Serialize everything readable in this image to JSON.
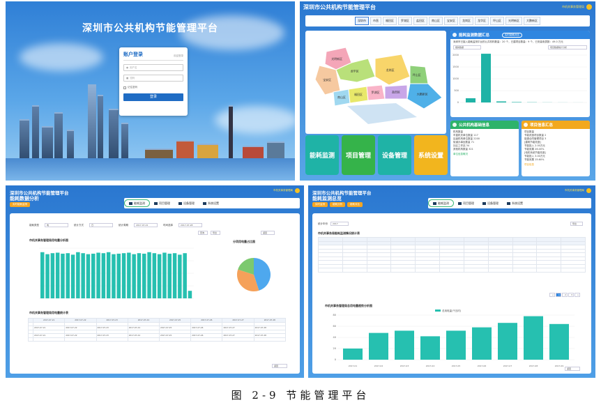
{
  "login_screen": {
    "title": "深圳市公共机构节能管理平台",
    "box_title": "账户登录",
    "box_hint": "欢迎登录",
    "username_placeholder": "用户名",
    "password_placeholder": "密码",
    "remember_label": "记住密码",
    "login_button": "登录"
  },
  "dashboard": {
    "title": "深圳市公共机构节能管理平台",
    "user_label": "市机关事务管理局",
    "districts": [
      "深圳市",
      "市直",
      "福田区",
      "罗湖区",
      "盐田区",
      "南山区",
      "宝安区",
      "龙岗区",
      "龙华区",
      "坪山区",
      "光明新区",
      "大鹏新区"
    ],
    "map_regions": [
      "光明新区",
      "宝安区",
      "龙华区",
      "龙岗区",
      "坪山区",
      "大鹏新区",
      "南山区",
      "福田区",
      "罗湖区",
      "盐田区"
    ],
    "tiles": [
      {
        "label": "能耗监测",
        "color": "#1fb3a6"
      },
      {
        "label": "项目管理",
        "color": "#35b34a"
      },
      {
        "label": "设备管理",
        "color": "#1fb3a6"
      },
      {
        "label": "系统设置",
        "color": "#f2b51e"
      }
    ],
    "monitor_card": {
      "title": "能耗监测数据汇总",
      "button": "实时能耗对比",
      "summary": "深圳市已接入能耗监测平台的公共机构数量：20 个，已建项目数量：9 个，已安装电表数：49.0 万元",
      "select_left": "能耗数据",
      "select_right": "项目数据统计分析",
      "bar_values": [
        200,
        2300,
        50,
        20,
        10,
        5,
        3,
        2
      ],
      "y_ticks": [
        "2000",
        "1500",
        "1000",
        "500",
        "0"
      ]
    },
    "info_card": {
      "title": "公共机构基础信息",
      "lines": [
        "机构数量",
        "市直机关单位数量  117",
        "区级机构单位数量  2200",
        "街道办事处数量  71",
        "社区工作站  34",
        "其他机构数量  321"
      ],
      "note": "机构信息查看请点击相应行，实时数据更新",
      "link": "单位信息概况"
    },
    "project_card": {
      "title": "项目信息汇总",
      "lines": [
        "项目数量",
        "节能改造项目数量  2",
        "能源合同管理项目  3",
        "[建筑节能改造]",
        "节能投入  2.00万元",
        "节能效果  26.00%",
        "[电机系统节能改造]",
        "节能投入  3.00万元",
        "节能效果  15.60%"
      ],
      "link": "项目信息"
    }
  },
  "analysis_screen": {
    "title": "深圳市公共机构节能管理平台",
    "subtitle": "能耗数据分析",
    "sub_buttons": [
      "实时能耗监测"
    ],
    "user_label": "市机关事务管理局",
    "nav": [
      "能耗监测",
      "项目管理",
      "设备管理",
      "系统设置"
    ],
    "filter_labels": [
      "能耗类型",
      "统计方式",
      "统计周期",
      "时间选择"
    ],
    "filter_values": [
      "电",
      "日",
      "2017-07-21",
      "2017-07-28"
    ],
    "buttons": [
      "查询",
      "导出",
      "返回"
    ],
    "bar_title": "市机关事务管理局用电量分析图",
    "pie_title": "分项用电量占比图",
    "table_title": "市机关事务管理局用电量统计表",
    "back_button": "返回",
    "bar_values": [
      92,
      88,
      90,
      91,
      89,
      90,
      87,
      92,
      90,
      88,
      89,
      91,
      90,
      92,
      88,
      89,
      90,
      91,
      88,
      90,
      89,
      92,
      90,
      88,
      91,
      89,
      90,
      87,
      90,
      15
    ],
    "pie_values": [
      45,
      35,
      20
    ],
    "pie_colors": [
      "#4ea8ee",
      "#f5a15a",
      "#7cc96f"
    ],
    "table_dates": [
      "2017-07-21",
      "2017-07-22",
      "2017-07-23",
      "2017-07-24",
      "2017-07-25",
      "2017-07-26",
      "2017-07-27",
      "2017-07-28"
    ]
  },
  "overview_screen": {
    "title": "深圳市公共机构节能管理平台",
    "subtitle": "能耗监测总览",
    "sub_buttons": [
      "实时监测",
      "能耗分析",
      "能耗对比"
    ],
    "user_label": "市机关事务管理局",
    "nav": [
      "能耗监测",
      "项目管理",
      "设备管理",
      "系统设置"
    ],
    "year_label": "统计年份",
    "year_value": "2017",
    "export_button": "导出",
    "table_title": "市机关事务局能耗监测情况统计表",
    "pager": [
      "<",
      "1",
      "2",
      "3",
      ">"
    ],
    "chart_title": "市机关事务管理局总用电量趋势分析图",
    "chart_legend": "总用电量(千瓦时)",
    "chart_values": [
      20,
      48,
      52,
      42,
      52,
      58,
      66,
      78,
      64
    ],
    "chart_categories": [
      "2017-01",
      "2017-02",
      "2017-03",
      "2017-04",
      "2017-05",
      "2017-06",
      "2017-07",
      "2017-08",
      "2017-09"
    ],
    "y_ticks": [
      "80",
      "60",
      "40",
      "20",
      "0"
    ],
    "back_button": "返回"
  },
  "figure_caption": "图 2-9  节能管理平台"
}
